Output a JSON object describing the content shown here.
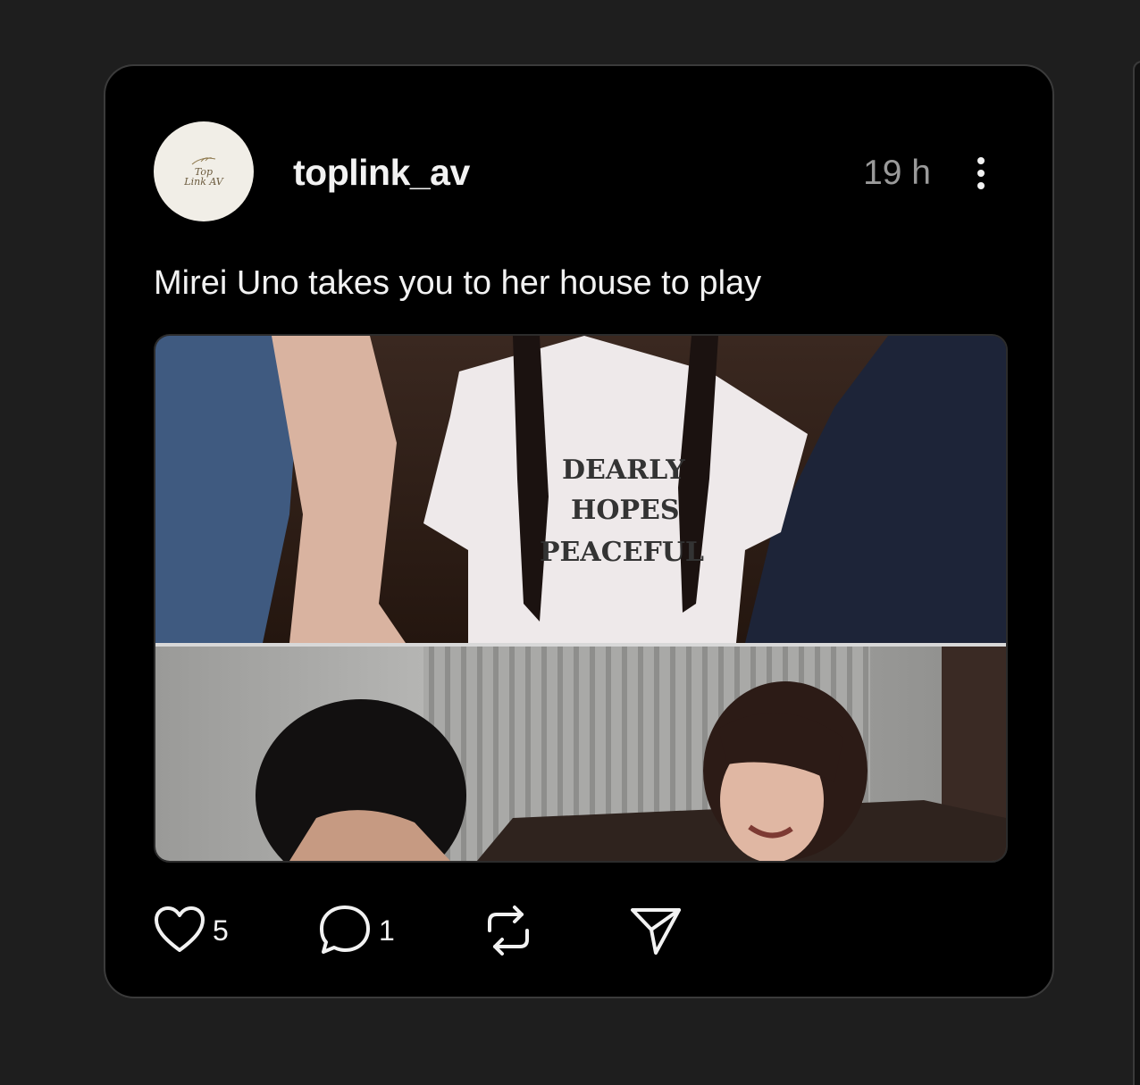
{
  "post": {
    "avatar": {
      "line1": "Top",
      "line2": "Link AV"
    },
    "username": "toplink_av",
    "time": "19 h",
    "caption": "Mirei Uno takes you to her house to play",
    "media": {
      "shirt_text": [
        "DEARLY",
        "HOPES",
        "PEACEFUL"
      ]
    },
    "actions": {
      "like_count": "5",
      "comment_count": "1"
    }
  },
  "icons": {
    "like": "heart-icon",
    "comment": "comment-bubble-icon",
    "repost": "repost-icon",
    "share": "send-icon",
    "more": "more-vertical-icon"
  },
  "colors": {
    "background": "#1e1e1e",
    "card": "#000000",
    "text": "#f2f2f2",
    "muted": "#9a9a9a"
  }
}
